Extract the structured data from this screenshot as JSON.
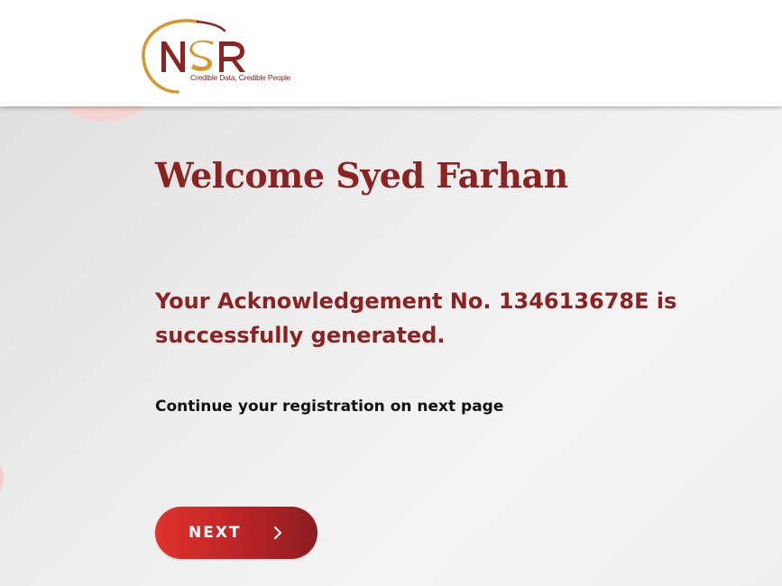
{
  "header": {
    "logo_text": "NSR",
    "logo_tagline": "Credible Data, Credible People",
    "colors": {
      "logo_arc": "#d9962a",
      "logo_letters": "#8b2323",
      "logo_s": "#d9962a"
    }
  },
  "main": {
    "welcome_heading": "Welcome Syed Farhan",
    "acknowledgement_message": "Your Acknowledgement No. 134613678E is successfully generated.",
    "continue_text": "Continue your registration on next page",
    "next_button": {
      "label": "NEXT",
      "icon": "chevron-right-icon"
    }
  },
  "colors": {
    "accent": "#8b2323",
    "button_start": "#e0332c",
    "button_end": "#8b1d20",
    "background": "#ececec"
  }
}
